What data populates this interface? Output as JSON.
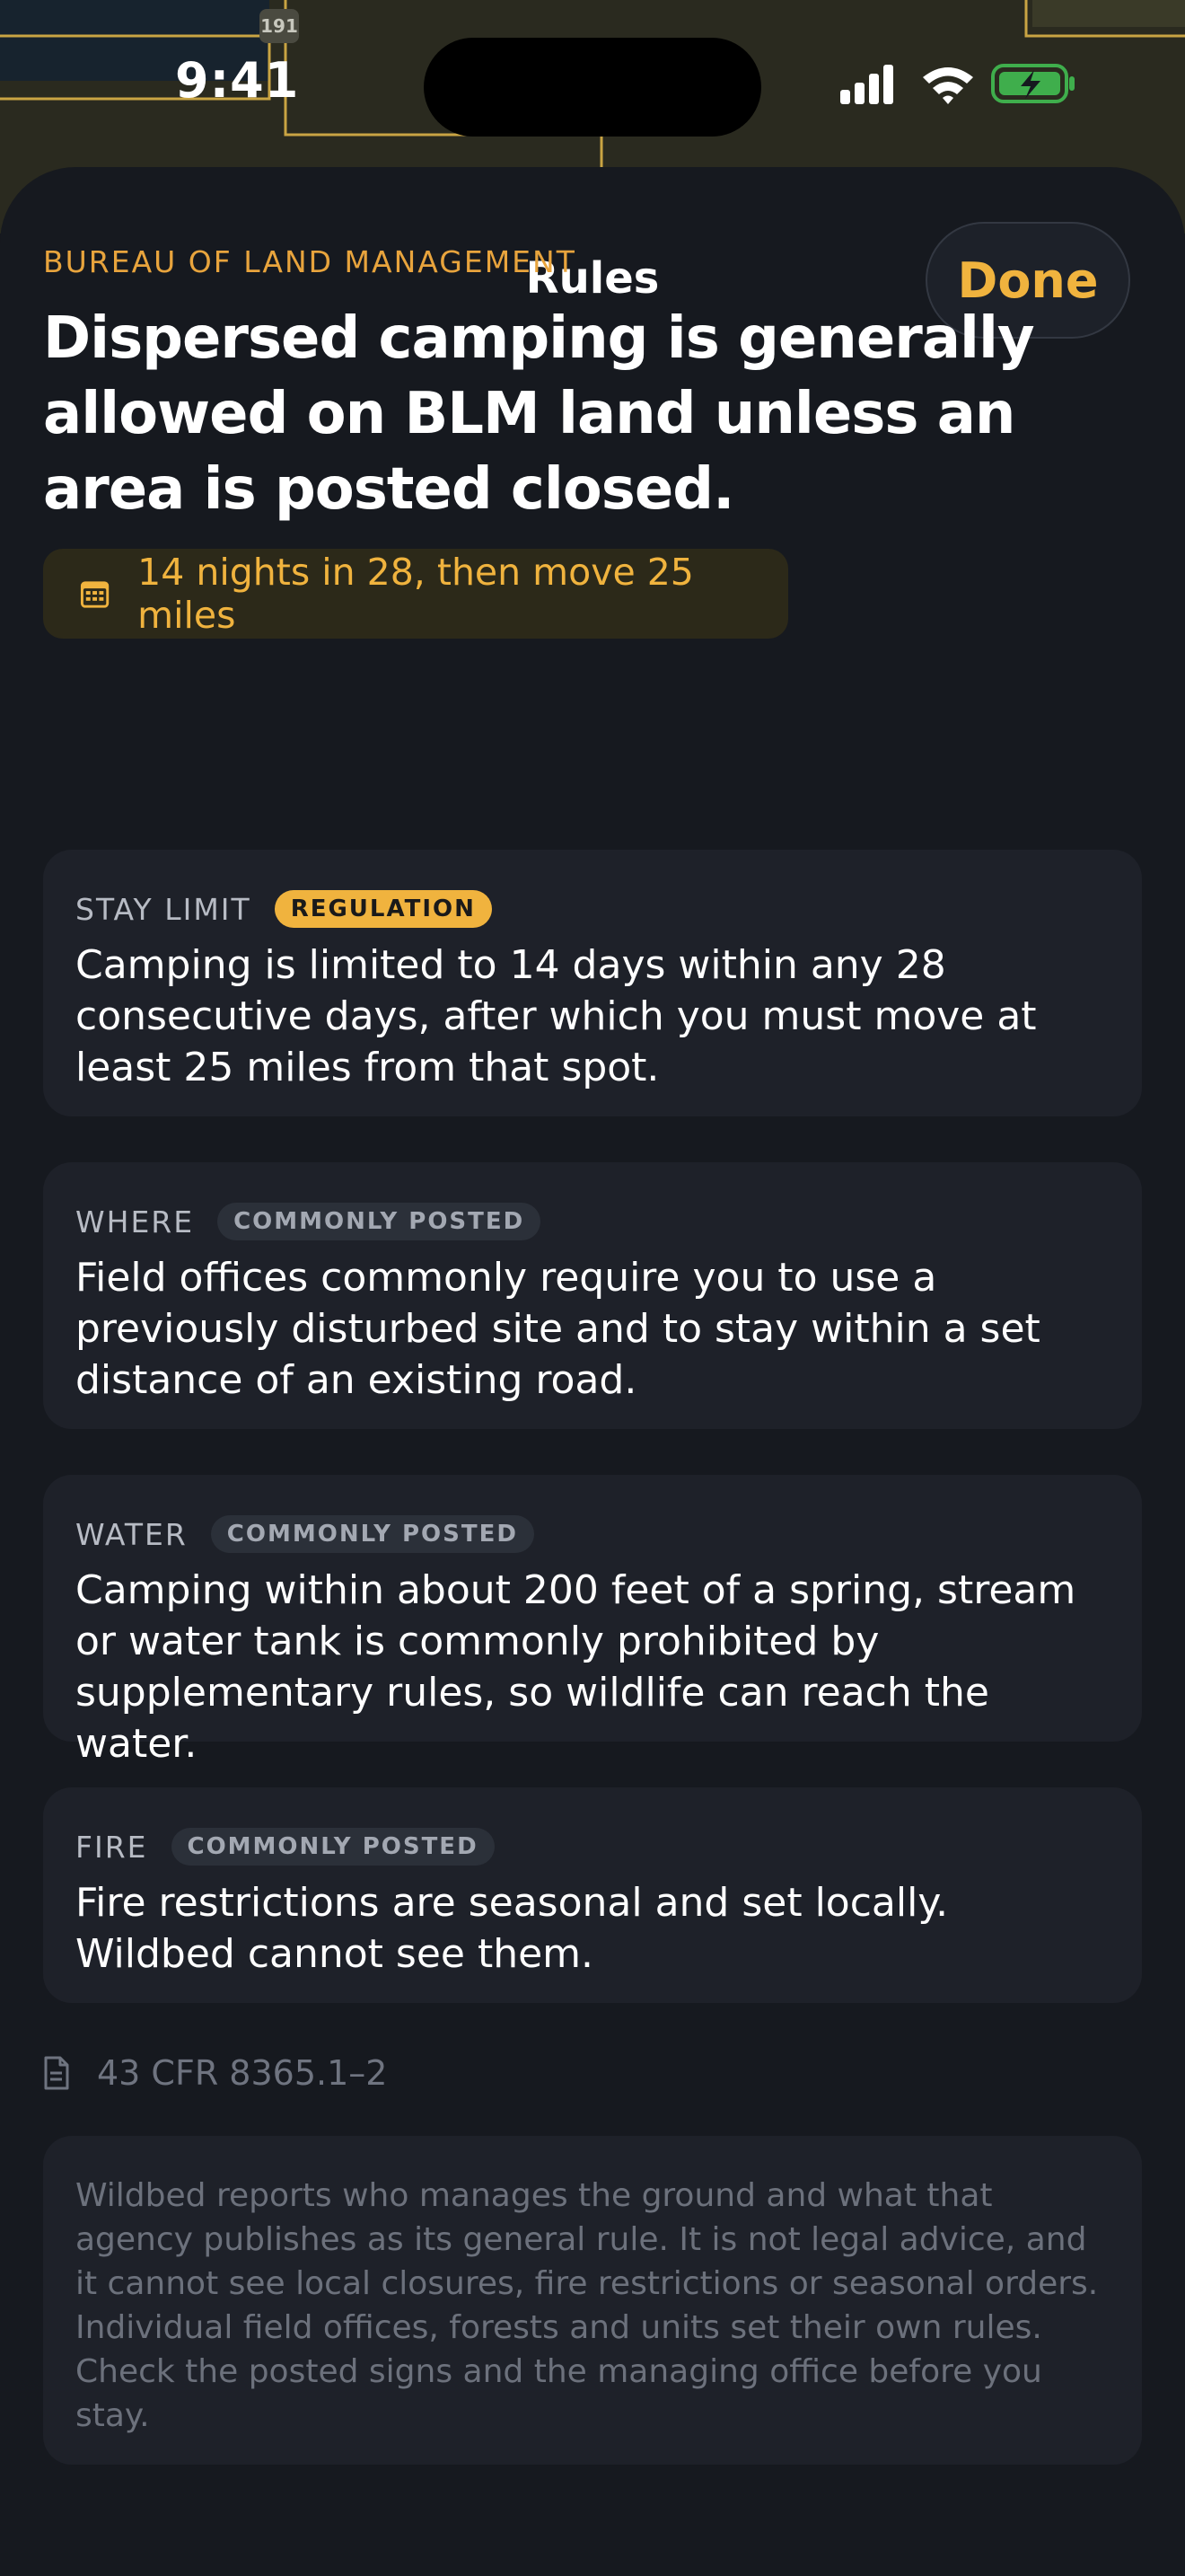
{
  "status_bar": {
    "time": "9:41"
  },
  "map": {
    "route_shield": "191"
  },
  "nav": {
    "title": "Rules",
    "done_label": "Done"
  },
  "agency": "BUREAU OF LAND MANAGEMENT",
  "headline": "Dispersed camping is generally allowed on BLM land unless an area is posted closed.",
  "limit_pill": {
    "icon": "calendar-icon",
    "text": "14 nights in 28, then move 25 miles"
  },
  "cards": [
    {
      "label": "STAY LIMIT",
      "badge": "REGULATION",
      "body": "Camping is limited to 14 days within any 28 consecutive days, after which you must move at least 25 miles from that spot."
    },
    {
      "label": "WHERE",
      "badge": "COMMONLY POSTED",
      "body": "Field offices commonly require you to use a previously disturbed site and to stay within a set distance of an existing road."
    },
    {
      "label": "WATER",
      "badge": "COMMONLY POSTED",
      "body": "Camping within about 200 feet of a spring, stream or water tank is commonly prohibited by supplementary rules, so wildlife can reach the water."
    },
    {
      "label": "FIRE",
      "badge": "COMMONLY POSTED",
      "body": "Fire restrictions are seasonal and set locally. Wildbed cannot see them."
    }
  ],
  "citation": {
    "icon": "document-icon",
    "text": "43 CFR 8365.1–2"
  },
  "disclaimer": "Wildbed reports who manages the ground and what that agency publishes as its general rule. It is not legal advice, and it cannot see local closures, fire restrictions or seasonal orders. Individual field offices, forests and units set their own rules. Check the posted signs and the managing office before you stay.",
  "colors": {
    "accent": "#f0b33e",
    "background": "#16191f",
    "card": "#1e2129"
  }
}
